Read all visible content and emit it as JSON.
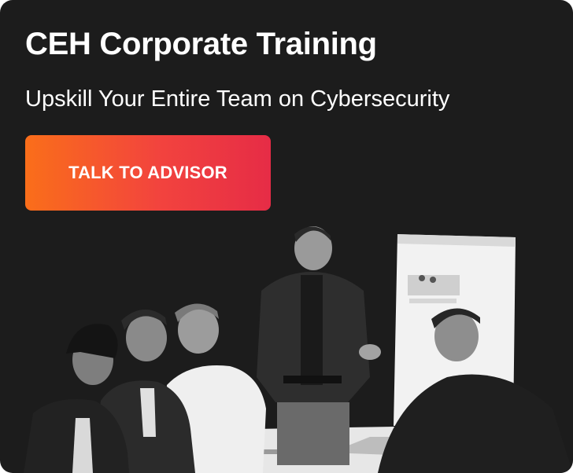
{
  "banner": {
    "title": "CEH Corporate Training",
    "subtitle": "Upskill Your Entire Team on Cybersecurity",
    "cta_label": "TALK TO ADVISOR"
  },
  "colors": {
    "background": "#1c1c1c",
    "cta_gradient_start": "#fa6e1a",
    "cta_gradient_end": "#e62c46",
    "text": "#ffffff"
  },
  "image": {
    "subject": "grayscale-photo-corporate-training-meeting"
  }
}
